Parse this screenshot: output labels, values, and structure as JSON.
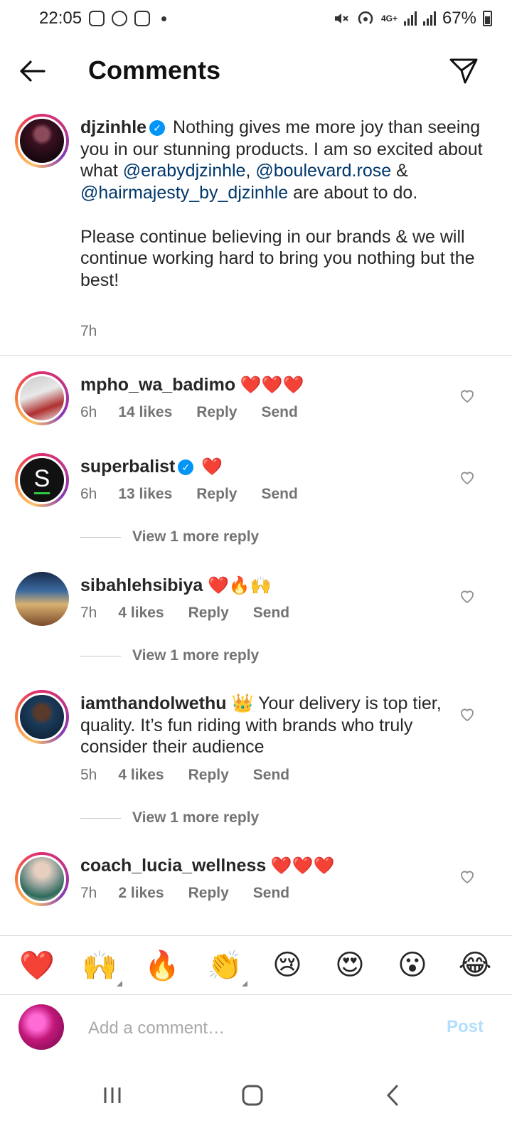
{
  "status_bar": {
    "time": "22:05",
    "network": "4G+",
    "battery": "67%"
  },
  "header": {
    "title": "Comments"
  },
  "caption": {
    "username": "djzinhle",
    "text_1": " Nothing gives me more joy than seeing you in our stunning products. I am so excited about what ",
    "mention_1": "@erabydjzinhle",
    "text_2": ", ",
    "mention_2": "@boulevard.rose",
    "text_3": " & ",
    "mention_3": "@hairmajesty_by_djzinhle",
    "text_4": " are about to do.",
    "paragraph_2": "Please continue believing in our brands & we will continue working hard to bring you nothing but the best!",
    "time": "7h"
  },
  "comments": [
    {
      "username": "mpho_wa_badimo",
      "text": " ❤️❤️❤️",
      "time": "6h",
      "likes": "14 likes",
      "reply": "Reply",
      "send": "Send"
    },
    {
      "username": "superbalist",
      "text": " ❤️",
      "time": "6h",
      "likes": "13 likes",
      "reply": "Reply",
      "send": "Send",
      "view_more": "View 1 more reply"
    },
    {
      "username": "sibahlehsibiya",
      "text": " ❤️🔥🙌",
      "time": "7h",
      "likes": "4 likes",
      "reply": "Reply",
      "send": "Send",
      "view_more": "View 1 more reply"
    },
    {
      "username": "iamthandolwethu",
      "text": " 👑 Your delivery is top tier, quality. It’s fun riding with brands who truly consider their audience",
      "time": "5h",
      "likes": "4 likes",
      "reply": "Reply",
      "send": "Send",
      "view_more": "View 1 more reply"
    },
    {
      "username": "coach_lucia_wellness",
      "text": " ❤️❤️❤️",
      "time": "7h",
      "likes": "2 likes",
      "reply": "Reply",
      "send": "Send"
    }
  ],
  "emoji_bar": [
    "❤️",
    "🙌",
    "🔥",
    "👏",
    "😢",
    "😍",
    "😮",
    "😂"
  ],
  "input": {
    "placeholder": "Add a comment…",
    "post_label": "Post"
  },
  "colors": {
    "link": "#00376b",
    "meta": "#737373",
    "verified": "#0095f6",
    "post_disabled": "#b2dffc"
  }
}
